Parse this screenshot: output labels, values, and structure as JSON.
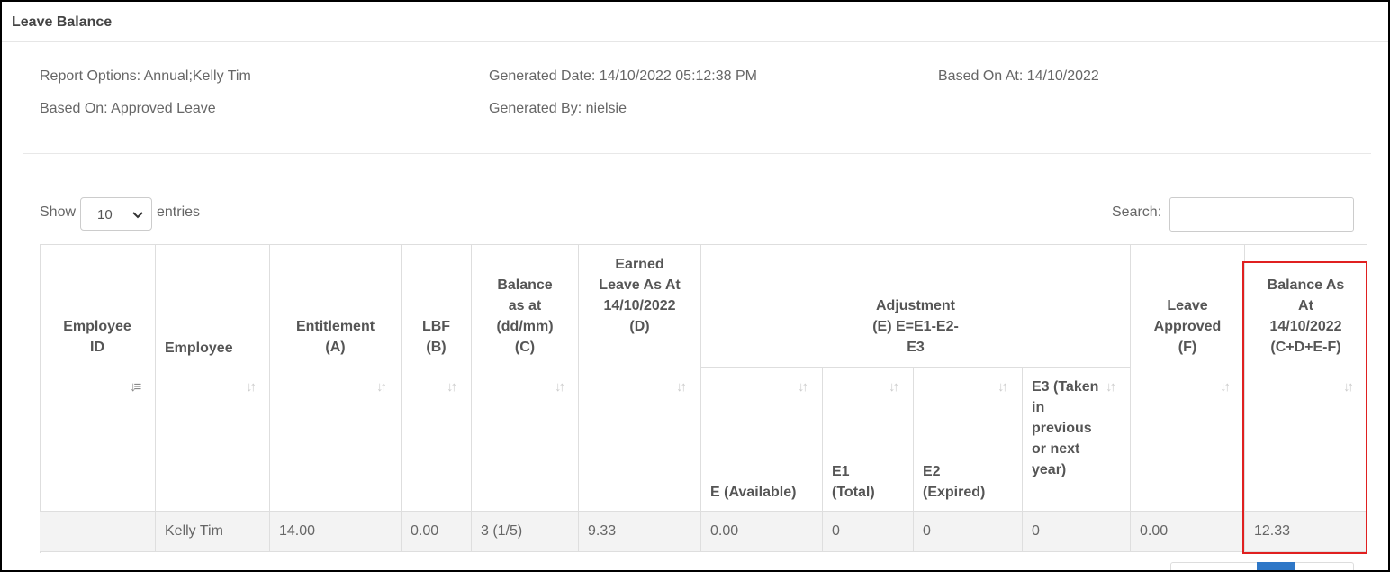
{
  "panel": {
    "title": "Leave Balance"
  },
  "meta": {
    "report_options": "Report Options: Annual;Kelly Tim",
    "based_on": "Based On: Approved Leave",
    "generated_date": "Generated Date: 14/10/2022 05:12:38 PM",
    "generated_by": "Generated By: nielsie",
    "based_on_at": "Based On At: 14/10/2022"
  },
  "controls": {
    "show_label": "Show",
    "entries_value": "10",
    "entries_label": "entries",
    "search_label": "Search:",
    "search_value": ""
  },
  "table": {
    "headers": {
      "employee_id": "Employee ID",
      "employee": "Employee",
      "entitlement": "Entitlement (A)",
      "lbf": "LBF (B)",
      "balance_as_at": "Balance as at (dd/mm) (C)",
      "earned_leave": "Earned Leave As At 14/10/2022 (D)",
      "adjustment": "Adjustment (E) E=E1-E2-E3",
      "e_available": "E (Available)",
      "e1_total": "E1 (Total)",
      "e2_expired": "E2 (Expired)",
      "e3_taken": "E3 (Taken in previous or next year)",
      "leave_approved": "Leave Approved (F)",
      "balance_as_at_date": "Balance As At 14/10/2022 (C+D+E-F)"
    },
    "rows": [
      {
        "employee_id": "",
        "employee": "Kelly Tim",
        "entitlement": "14.00",
        "lbf": "0.00",
        "balance_as_at": "3 (1/5)",
        "earned_leave": "9.33",
        "e_available": "0.00",
        "e1_total": "0",
        "e2_expired": "0",
        "e3_taken": "0",
        "leave_approved": "0.00",
        "balance_as_at_date": "12.33"
      }
    ]
  },
  "colors": {
    "highlight": "#e02020",
    "pager_active": "#2e77c7"
  },
  "icons": {
    "sort": "sort-arrows-icon",
    "sort_active": "sort-ascending-icon",
    "dropdown": "chevron-down-icon"
  }
}
